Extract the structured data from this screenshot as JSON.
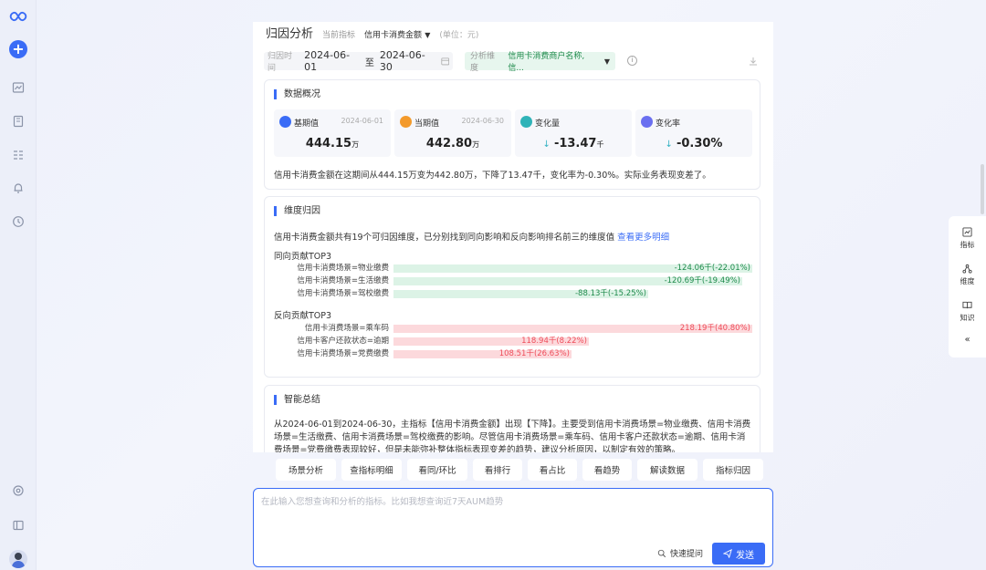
{
  "colors": {
    "accent": "#3a6cf6",
    "positive": "#1f8b4c",
    "negative": "#ee4d5a"
  },
  "sidebar": {
    "icons": [
      "logo-icon",
      "new-chat-icon",
      "chart-icon",
      "book-icon",
      "table-icon",
      "bell-icon",
      "clock-icon",
      "settings-icon",
      "layout-icon",
      "avatar"
    ]
  },
  "header": {
    "title": "归因分析",
    "metric_label": "当前指标",
    "metric_value": "信用卡消费金额",
    "unit": "(单位：元)"
  },
  "filters": {
    "date_label": "归因时间",
    "start_date": "2024-06-01",
    "to": "至",
    "end_date": "2024-06-30",
    "dim_label": "分析维度",
    "dim_value": "信用卡消费商户名称,信..."
  },
  "overview": {
    "title": "数据概况",
    "kpis": [
      {
        "label": "基期值",
        "date": "2024-06-01",
        "value": "444.15",
        "unit": "万",
        "arrow": "",
        "color": "#3a6cf6"
      },
      {
        "label": "当期值",
        "date": "2024-06-30",
        "value": "442.80",
        "unit": "万",
        "arrow": "",
        "color": "#f39a2b"
      },
      {
        "label": "变化量",
        "date": "",
        "value": "-13.47",
        "unit": "千",
        "arrow": "↓",
        "color": "#2fb3b8"
      },
      {
        "label": "变化率",
        "date": "",
        "value": "-0.30%",
        "unit": "",
        "arrow": "↓",
        "color": "#6a6ff0"
      }
    ],
    "summary": "信用卡消费金额在这期间从444.15万变为442.80万，下降了13.47千，变化率为-0.30%。实际业务表现变差了。"
  },
  "dimension": {
    "title": "维度归因",
    "desc": "信用卡消费金额共有19个可归因维度，已分别找到同向影响和反向影响排名前三的维度值",
    "more_link": "查看更多明细",
    "positive_title": "同向贡献TOP3",
    "negative_title": "反向贡献TOP3",
    "positive": [
      {
        "label": "信用卡消费场景=物业缴费",
        "text": "-124.06千(-22.01%)",
        "fraction": 1.0
      },
      {
        "label": "信用卡消费场景=生活缴费",
        "text": "-120.69千(-19.49%)",
        "fraction": 0.973
      },
      {
        "label": "信用卡消费场景=驾校缴费",
        "text": "-88.13千(-15.25%)",
        "fraction": 0.71
      }
    ],
    "negative": [
      {
        "label": "信用卡消费场景=乘车码",
        "text": "218.19千(40.80%)",
        "fraction": 1.0
      },
      {
        "label": "信用卡客户还款状态=逾期",
        "text": "118.94千(8.22%)",
        "fraction": 0.545
      },
      {
        "label": "信用卡消费场景=党费缴费",
        "text": "108.51千(26.63%)",
        "fraction": 0.497
      }
    ]
  },
  "ai_summary": {
    "title": "智能总结",
    "text": "从2024-06-01到2024-06-30，主指标【信用卡消费金额】出现【下降】。主要受到信用卡消费场景=物业缴费、信用卡消费场景=生活缴费、信用卡消费场景=驾校缴费的影响。尽管信用卡消费场景=乘车码、信用卡客户还款状态=逾期、信用卡消费场景=党费缴费表现较好，但是未能弥补整体指标表现变差的趋势，建议分析原因，以制定有效的策略。"
  },
  "actions": [
    "场景分析",
    "查指标明细",
    "看同/环比",
    "看排行",
    "看占比",
    "看趋势",
    "解读数据",
    "指标归因"
  ],
  "input": {
    "placeholder": "在此输入您想查询和分析的指标。比如我想查询近7天AUM趋势",
    "quick_word": "快速提问",
    "send": "发送"
  },
  "right_toolbar": [
    "指标",
    "维度",
    "知识"
  ]
}
